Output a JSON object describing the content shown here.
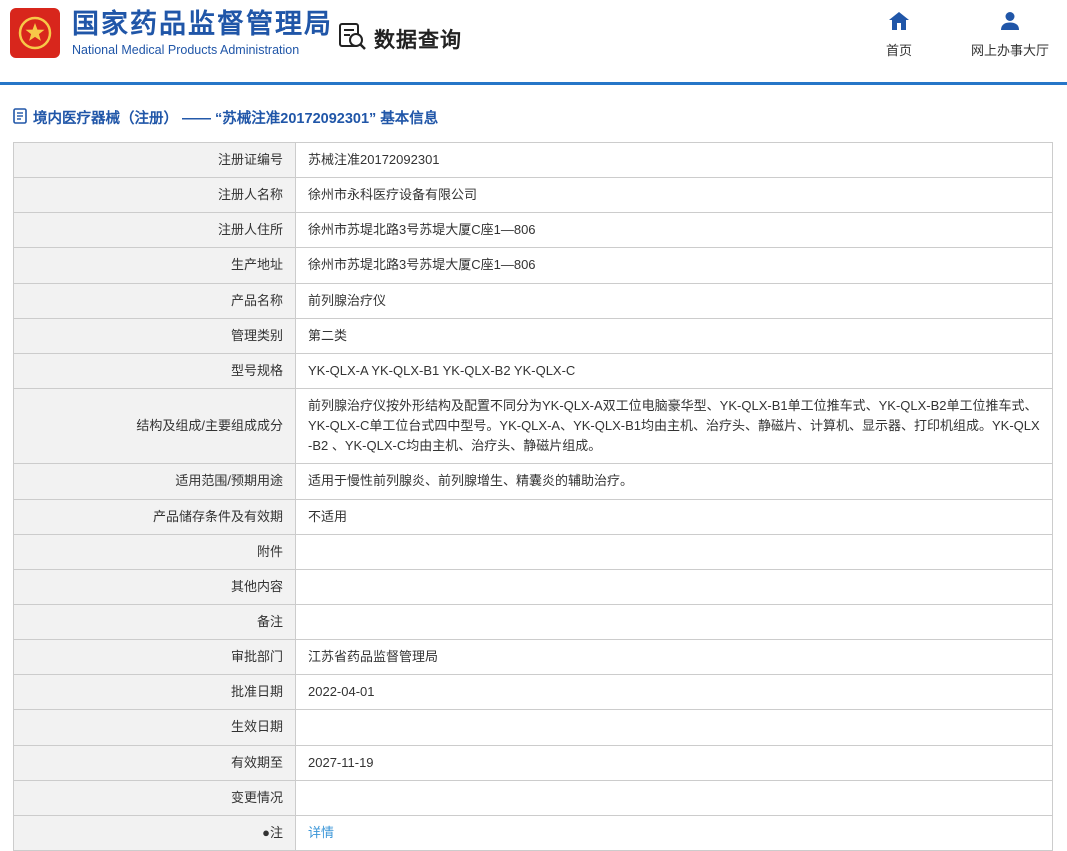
{
  "header": {
    "org_name_cn": "国家药品监督管理局",
    "org_name_en": "National Medical Products Administration",
    "section_title": "数据查询",
    "nav": [
      {
        "label": "首页",
        "icon": "home-icon"
      },
      {
        "label": "网上办事大厅",
        "icon": "person-icon"
      }
    ],
    "colors": {
      "brand_blue": "#2056a8",
      "divider_blue": "#2676c8",
      "emblem_red": "#d8261c",
      "emblem_gold": "#f7c948",
      "link_blue": "#3b96d8"
    }
  },
  "breadcrumb": {
    "text": "境内医疗器械（注册） —— “苏械注准20172092301” 基本信息"
  },
  "table": {
    "rows": [
      {
        "label": "注册证编号",
        "value": "苏械注准20172092301"
      },
      {
        "label": "注册人名称",
        "value": "徐州市永科医疗设备有限公司"
      },
      {
        "label": "注册人住所",
        "value": "徐州市苏堤北路3号苏堤大厦C座1—806"
      },
      {
        "label": "生产地址",
        "value": "徐州市苏堤北路3号苏堤大厦C座1—806"
      },
      {
        "label": "产品名称",
        "value": "前列腺治疗仪"
      },
      {
        "label": "管理类别",
        "value": "第二类"
      },
      {
        "label": "型号规格",
        "value": "YK-QLX-A YK-QLX-B1 YK-QLX-B2 YK-QLX-C"
      },
      {
        "label": "结构及组成/主要组成成分",
        "value": "前列腺治疗仪按外形结构及配置不同分为YK-QLX-A双工位电脑豪华型、YK-QLX-B1单工位推车式、YK-QLX-B2单工位推车式、 YK-QLX-C单工位台式四中型号。YK-QLX-A、YK-QLX-B1均由主机、治疗头、静磁片、计算机、显示器、打印机组成。YK-QLX-B2 、YK-QLX-C均由主机、治疗头、静磁片组成。"
      },
      {
        "label": "适用范围/预期用途",
        "value": "适用于慢性前列腺炎、前列腺增生、精囊炎的辅助治疗。"
      },
      {
        "label": "产品储存条件及有效期",
        "value": "不适用"
      },
      {
        "label": "附件",
        "value": ""
      },
      {
        "label": "其他内容",
        "value": ""
      },
      {
        "label": "备注",
        "value": ""
      },
      {
        "label": "审批部门",
        "value": "江苏省药品监督管理局"
      },
      {
        "label": "批准日期",
        "value": "2022-04-01"
      },
      {
        "label": "生效日期",
        "value": ""
      },
      {
        "label": "有效期至",
        "value": "2027-11-19"
      },
      {
        "label": "变更情况",
        "value": ""
      },
      {
        "label": "●注",
        "value": "详情",
        "link": true
      }
    ]
  }
}
